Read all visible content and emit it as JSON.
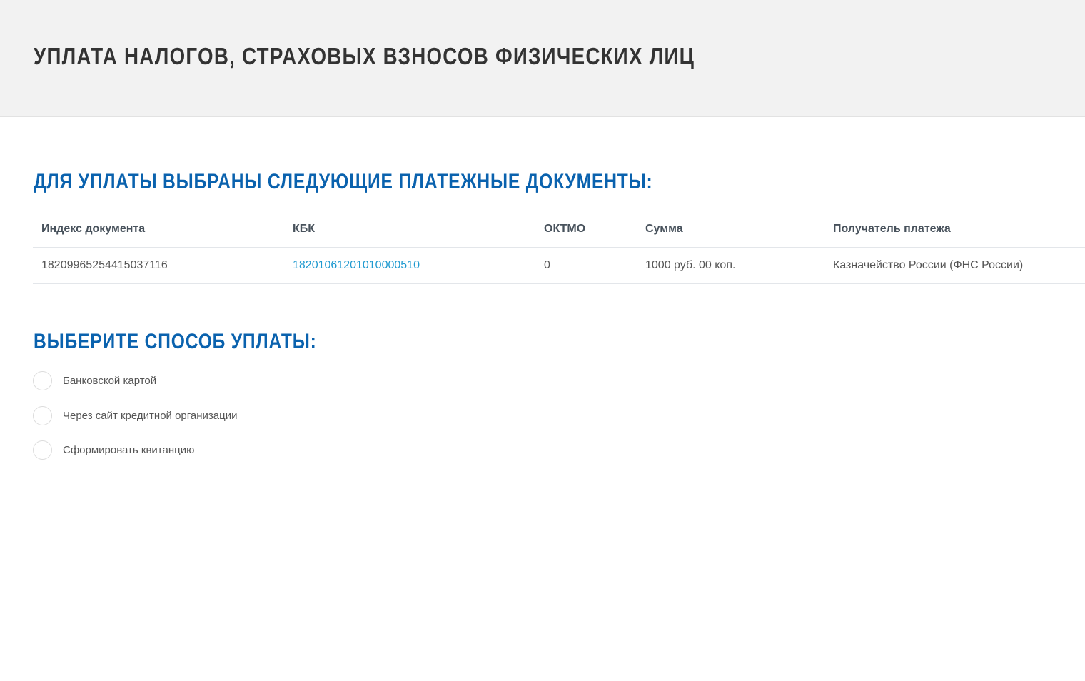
{
  "header": {
    "title": "УПЛАТА НАЛОГОВ, СТРАХОВЫХ ВЗНОСОВ ФИЗИЧЕСКИХ ЛИЦ"
  },
  "documents": {
    "heading": "ДЛЯ УПЛАТЫ ВЫБРАНЫ СЛЕДУЮЩИЕ ПЛАТЕЖНЫЕ ДОКУМЕНТЫ:",
    "columns": [
      "Индекс документа",
      "КБК",
      "ОКТМО",
      "Сумма",
      "Получатель платежа"
    ],
    "rows": [
      {
        "index": "18209965254415037116",
        "kbk": "18201061201010000510",
        "oktmo": "0",
        "sum": "1000 руб. 00 коп.",
        "recipient": "Казначейство России (ФНС России)"
      }
    ]
  },
  "payment": {
    "heading": "ВЫБЕРИТЕ СПОСОБ УПЛАТЫ:",
    "options": [
      "Банковской картой",
      "Через сайт кредитной организации",
      "Сформировать квитанцию"
    ]
  }
}
